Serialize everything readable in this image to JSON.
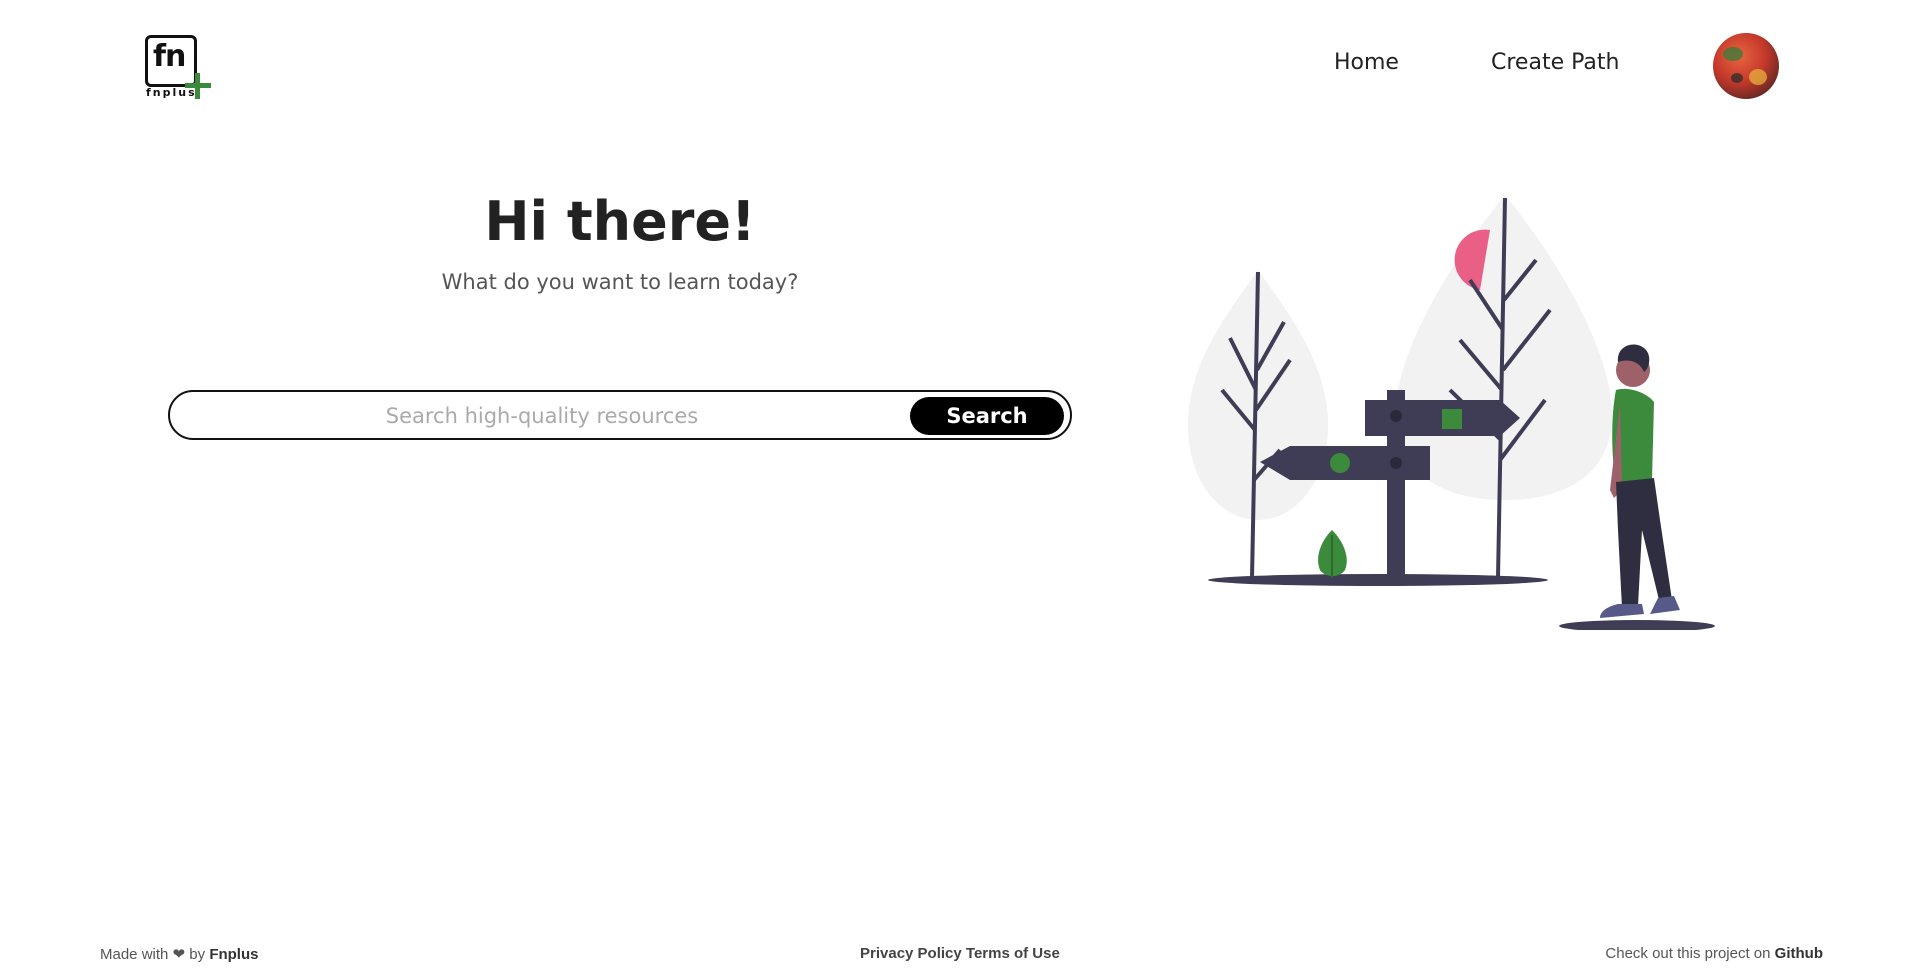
{
  "header": {
    "logo_text": "fn",
    "logo_subtext": "fnplus",
    "nav": [
      {
        "label": "Home"
      },
      {
        "label": "Create Path"
      }
    ]
  },
  "hero": {
    "title": "Hi there!",
    "subtitle": "What do you want to learn today?"
  },
  "search": {
    "placeholder": "Search high-quality resources",
    "value": "",
    "button_label": "Search"
  },
  "footer": {
    "made_with_prefix": "Made with",
    "heart": "❤",
    "made_with_by": "by",
    "made_with_brand": "Fnplus",
    "privacy_label": "Privacy Policy",
    "terms_label": "Terms of Use",
    "project_prefix": "Check out this project on",
    "github_label": "Github"
  },
  "colors": {
    "accent_green": "#3c8b3c",
    "sign_dark": "#3f3d56",
    "sun_pink": "#e95f85",
    "tree_light": "#f2f2f2"
  },
  "icons": {
    "logo_plus": "plus-icon",
    "avatar": "user-avatar",
    "heart": "heart-icon"
  }
}
